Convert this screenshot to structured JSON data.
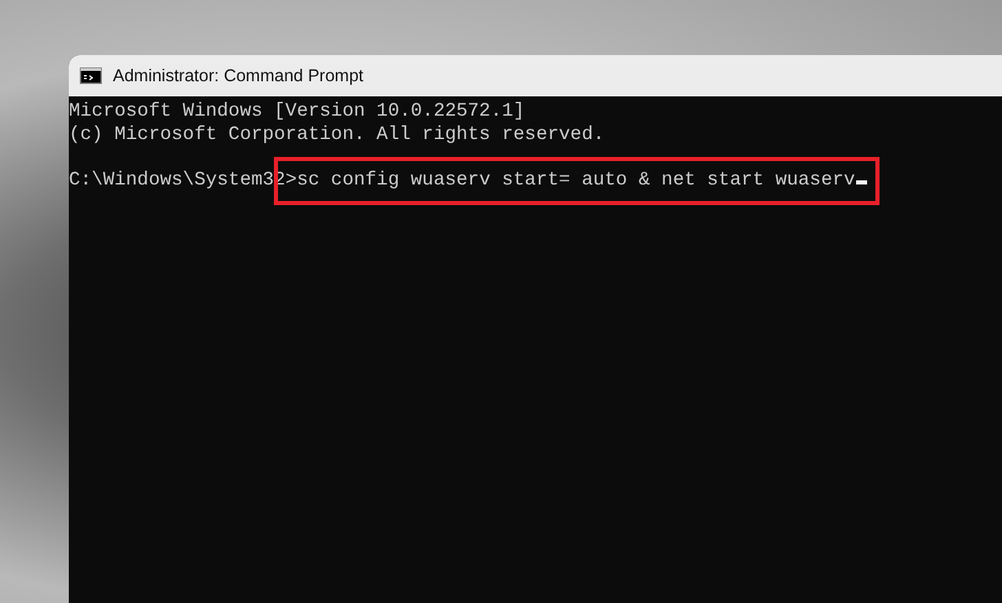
{
  "window": {
    "title": "Administrator: Command Prompt"
  },
  "console": {
    "lines": [
      "Microsoft Windows [Version 10.0.22572.1]",
      "(c) Microsoft Corporation. All rights reserved."
    ],
    "prompt": {
      "path": "C:\\Windows\\System32",
      "command": ">sc config wuaserv start= auto & net start wuaserv",
      "highlighted": true,
      "cursor": true
    }
  }
}
